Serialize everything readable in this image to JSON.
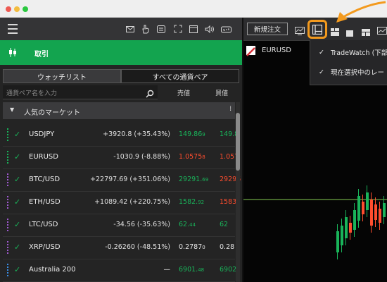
{
  "colors": {
    "brand_green": "#13a44f",
    "up_green": "#19b45a",
    "down_red": "#ff4d2e",
    "highlight_orange": "#f39a1e",
    "grip_green": "#19b45a",
    "grip_purple": "#a05ad0",
    "grip_blue": "#3a8ee6"
  },
  "app_toolbar": {
    "icons": [
      "menu-icon",
      "mail-icon",
      "hand-icon",
      "calculator-icon",
      "expand-icon",
      "window-icon",
      "sound-icon",
      "lock-icon"
    ]
  },
  "trade_header": {
    "label": "取引"
  },
  "tabs": [
    {
      "label": "ウォッチリスト"
    },
    {
      "label": "すべての通貨ペア"
    }
  ],
  "search": {
    "placeholder": "通貨ペア名を入力",
    "col_sell": "売値",
    "col_buy": "買値"
  },
  "section": {
    "label": "人気のマーケット"
  },
  "watchlist": [
    {
      "symbol": "USDJPY",
      "change": "+3920.8 (+35.43%)",
      "bid_main": "149.86",
      "bid_small": "9",
      "ask": "149.8",
      "direction": "up",
      "grip": "grip_green"
    },
    {
      "symbol": "EURUSD",
      "change": "-1030.9 (-8.88%)",
      "bid_main": "1.0575",
      "bid_small": "8",
      "ask": "1.057",
      "direction": "down",
      "grip": "grip_green"
    },
    {
      "symbol": "BTC/USD",
      "change": "+22797.69 (+351.06%)",
      "bid_main": "29291.",
      "bid_small": "69",
      "ask": "29296",
      "direction": "updown",
      "grip": "grip_purple"
    },
    {
      "symbol": "ETH/USD",
      "change": "+1089.42 (+220.75%)",
      "bid_main": "1582.",
      "bid_small": "92",
      "ask": "1583",
      "direction": "updown",
      "grip": "grip_purple"
    },
    {
      "symbol": "LTC/USD",
      "change": "-34.56 (-35.63%)",
      "bid_main": "62.",
      "bid_small": "44",
      "ask": "62",
      "direction": "up",
      "grip": "grip_purple"
    },
    {
      "symbol": "XRP/USD",
      "change": "-0.26260 (-48.51%)",
      "bid_main": "0.2787",
      "bid_small": "0",
      "ask": "0.28",
      "direction": "neutral",
      "grip": "grip_purple"
    },
    {
      "symbol": "Australia 200",
      "change": "—",
      "bid_main": "6901.",
      "bid_small": "48",
      "ask": "6902",
      "direction": "up",
      "grip": "grip_blue"
    }
  ],
  "right_toolbar": {
    "new_order": "新規注文",
    "icons": [
      "chart-icon",
      "layout-single-icon",
      "layout-grid-icon",
      "layout-square-icon",
      "layout-split-icon",
      "chart-window-icon"
    ]
  },
  "chart": {
    "symbol": "EURUSD"
  },
  "dropdown": {
    "items": [
      {
        "label": "TradeWatch (下部",
        "checked": true
      },
      {
        "label": "現在選択中のレー",
        "checked": true
      }
    ]
  }
}
